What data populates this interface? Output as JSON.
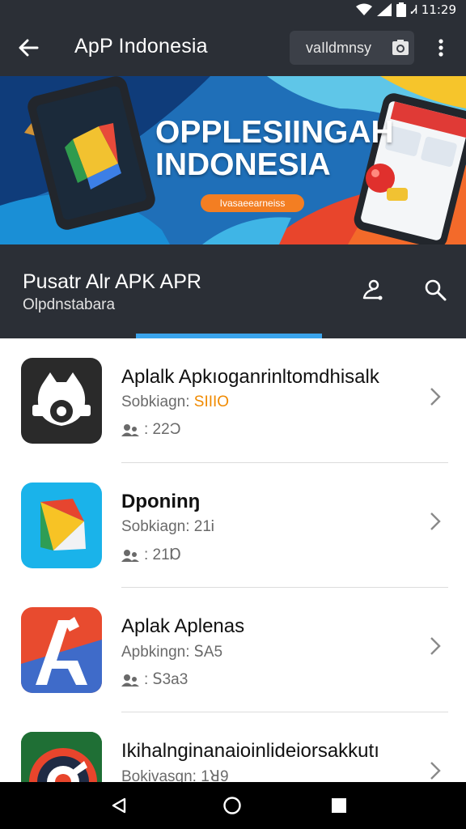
{
  "status_bar": {
    "time": "Ꮧ 11:29",
    "icons": [
      "wifi-icon",
      "signal-icon",
      "battery-icon"
    ]
  },
  "app_bar": {
    "title": "ApP Indonesia",
    "search_chip_label": "vaIldmnsy",
    "icons": [
      "back-arrow-icon",
      "camera-icon",
      "more-vert-icon"
    ]
  },
  "banner": {
    "title_line1": "OPPLESIINGAH",
    "title_line2": "INDONESIA",
    "pill_label": "Ivasaeearneiss"
  },
  "section": {
    "title": "Pusatr Alr APK APR",
    "subtitle": "Olpdnstabara",
    "icons": [
      "share-icon",
      "search-icon"
    ]
  },
  "apps": [
    {
      "name": "Aplalk Apkıoganrinltomdhisalk",
      "meta_label": "Sobkiagn:",
      "meta_value": "SIIIO",
      "rating": ": 22Ɔ"
    },
    {
      "name": "Dponinŋ",
      "meta_label": "Sobkiagn:",
      "meta_value": "21Ꭵ",
      "rating": ": 21Ɒ"
    },
    {
      "name": "Aplak Aplenas",
      "meta_label": "Apbkingn:",
      "meta_value": "ꓢA5",
      "rating": ": ꓢ3a3"
    },
    {
      "name": "Ikihalnginanaioinlideiorsakkutı",
      "meta_label": "Bokivasgn:",
      "meta_value": "1ꓤ9",
      "rating": ""
    }
  ],
  "colors": {
    "bar_dark": "#2b2f36",
    "accent_blue": "#3aa4ec",
    "accent_orange": "#f37e22",
    "meta_highlight": "#f08a00"
  },
  "nav_bar": {
    "icons": [
      "back-triangle-icon",
      "home-circle-icon",
      "recents-square-icon"
    ]
  }
}
